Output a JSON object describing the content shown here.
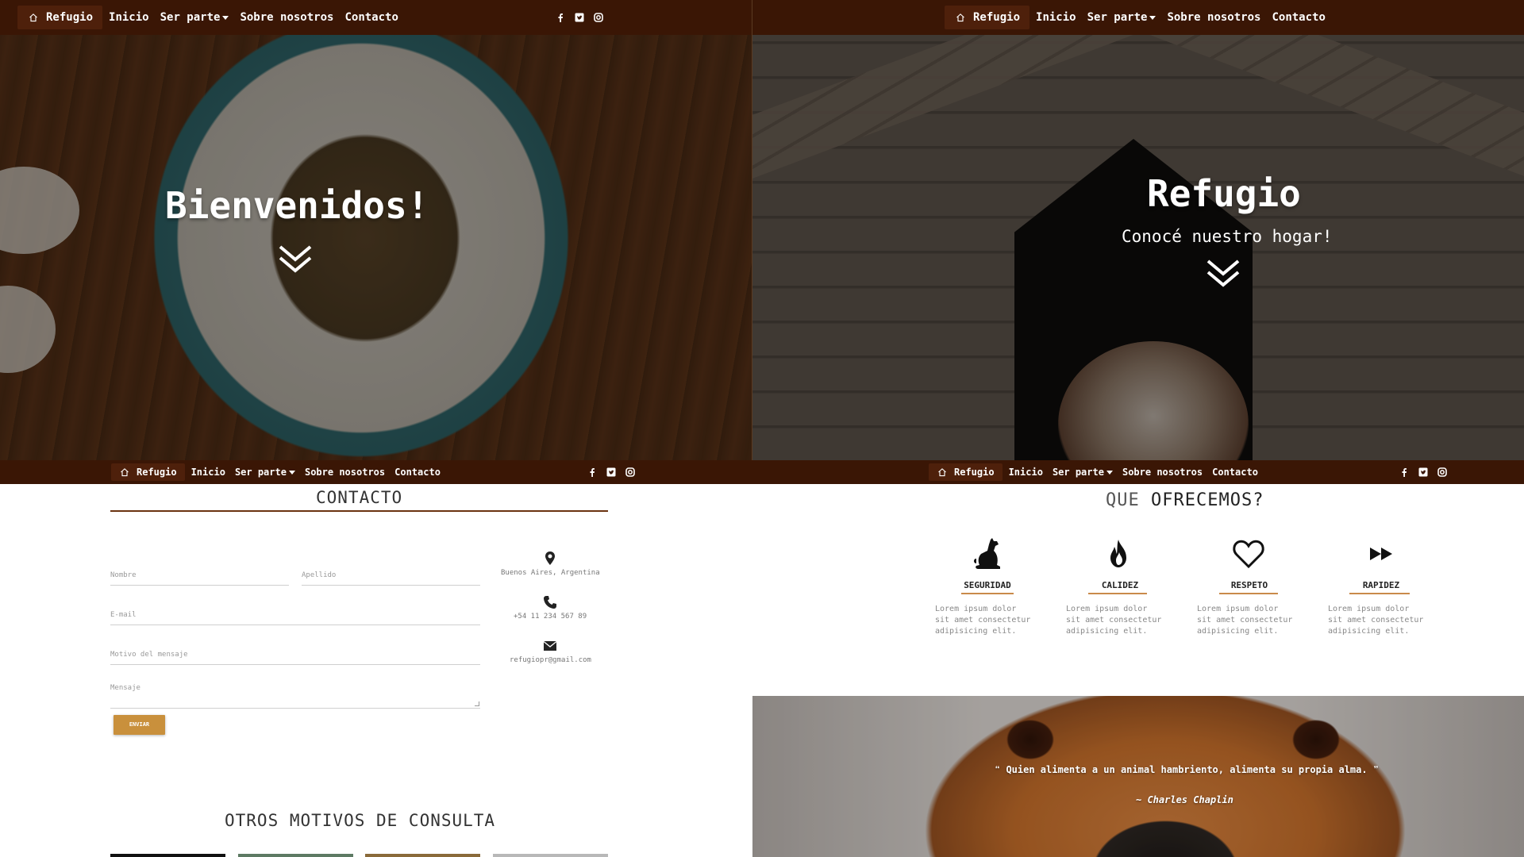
{
  "navbar": {
    "brand": "Refugio",
    "links": [
      "Inicio",
      "Ser parte",
      "Sobre nosotros",
      "Contacto"
    ],
    "social_icons": [
      "facebook-icon",
      "twitter-icon",
      "instagram-icon"
    ]
  },
  "hero_welcome": {
    "title": "Bienvenidos!"
  },
  "hero_refugio": {
    "title": "Refugio",
    "subtitle": "Conocé nuestro hogar!"
  },
  "contact": {
    "title": "CONTACTO",
    "fields": {
      "nombre": "Nombre",
      "apellido": "Apellido",
      "email": "E-mail",
      "motivo": "Motivo del mensaje",
      "mensaje": "Mensaje"
    },
    "info": {
      "location": "Buenos Aires, Argentina",
      "phone": "+54 11 234 567 89",
      "email": "refugiopr@gmail.com"
    },
    "send_button": "ENVIAR",
    "other_title": "OTROS MOTIVOS DE CONSULTA"
  },
  "offers": {
    "title_light": "QUE",
    "title_bold": "OFRECEMOS?",
    "items": [
      {
        "icon": "dog-icon",
        "title": "SEGURIDAD",
        "text": "Lorem ipsum dolor sit amet consectetur adipisicing elit."
      },
      {
        "icon": "fire-icon",
        "title": "CALIDEZ",
        "text": "Lorem ipsum dolor sit amet consectetur adipisicing elit."
      },
      {
        "icon": "heart-icon",
        "title": "RESPETO",
        "text": "Lorem ipsum dolor sit amet consectetur adipisicing elit."
      },
      {
        "icon": "fast-forward-icon",
        "title": "RAPIDEZ",
        "text": "Lorem ipsum dolor sit amet consectetur adipisicing elit."
      }
    ]
  },
  "quote": {
    "text": "Quien alimenta a un animal hambriento, alimenta su propia alma.",
    "author": "~ Charles Chaplin"
  },
  "colors": {
    "navbar_bg": "#3a1605",
    "brand_bg": "#4e200b",
    "accent": "#c9903c",
    "rule": "#6b3311"
  }
}
